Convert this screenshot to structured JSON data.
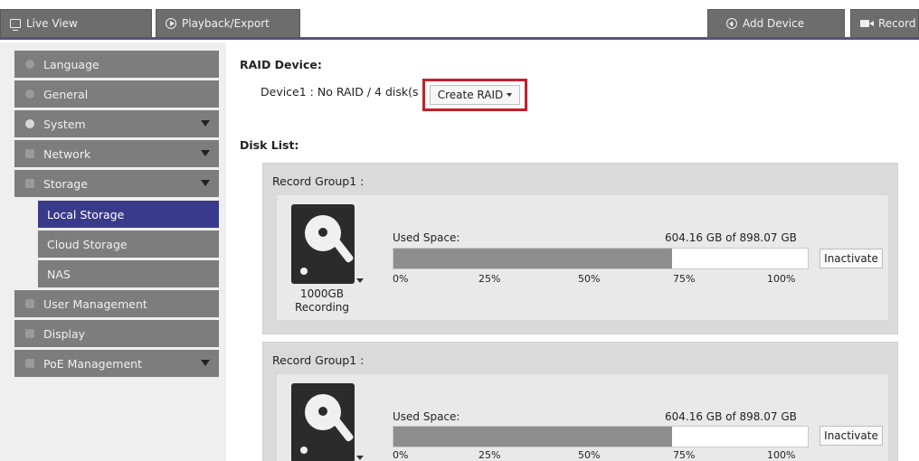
{
  "topbar": {
    "live_view": "Live View",
    "playback": "Playback/Export",
    "add_device": "Add Device",
    "record": "Record"
  },
  "menu": {
    "language": "Language",
    "general": "General",
    "system": "System",
    "network": "Network",
    "storage": "Storage",
    "local_storage": "Local Storage",
    "cloud_storage": "Cloud Storage",
    "nas": "NAS",
    "user_management": "User Management",
    "display": "Display",
    "poe_management": "PoE Management"
  },
  "main": {
    "raid_heading": "RAID Device:",
    "device_line": "Device1 : No RAID / 4 disk(s",
    "create_raid": "Create RAID",
    "disk_list_heading": "Disk List:"
  },
  "groups": [
    {
      "title": "Record Group1 :",
      "disk_size": "1000GB",
      "disk_status": "Recording",
      "used_label": "Used Space:",
      "used_value": "604.16 GB of 898.07 GB",
      "used_fraction": 0.6727,
      "ticks": [
        "0%",
        "25%",
        "50%",
        "75%",
        "100%"
      ],
      "action": "Inactivate"
    },
    {
      "title": "Record Group1 :",
      "used_label": "Used Space:",
      "used_value": "604.16 GB of 898.07 GB",
      "used_fraction": 0.6727,
      "ticks": [
        "0%",
        "25%",
        "50%",
        "75%",
        "100%"
      ],
      "action": "Inactivate"
    }
  ],
  "colors": {
    "active_menu": "#3a3a8c",
    "highlight_box": "#c4202a"
  }
}
